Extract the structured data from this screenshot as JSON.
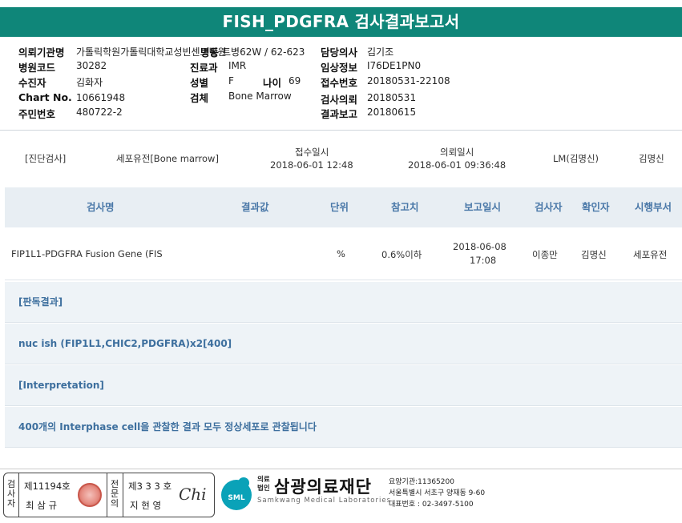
{
  "title": "FISH_PDGFRA 검사결과보고서",
  "patient": {
    "hospital_label": "의뢰기관명",
    "hospital_value": "가톨릭학원가톨릭대학교성빈센트병원",
    "ward_label": "병동",
    "ward_value": "트병62W / 62-623",
    "doctor_label": "담당의사",
    "doctor_value": "김기조",
    "code_label": "병원코드",
    "code_value": "30282",
    "dept_label": "진료과",
    "dept_value": "IMR",
    "clinical_label": "임상정보",
    "clinical_value": "I76DE1PN0",
    "patient_label": "수진자",
    "patient_value": "김화자",
    "sex_label": "성별",
    "sex_value": "F",
    "age_label": "나이",
    "age_value": "69",
    "receipt_label": "접수번호",
    "receipt_value": "20180531-22108",
    "chart_label": "Chart No.",
    "chart_value": "10661948",
    "specimen_label": "검체",
    "specimen_value": "Bone Marrow",
    "request_label": "검사의뢰",
    "request_value": "20180531",
    "resident_label": "주민번호",
    "resident_value": "480722-2",
    "report_label": "결과보고",
    "report_value": "20180615"
  },
  "sample": {
    "category": "[진단검사]",
    "dept": "세포유전[Bone marrow]",
    "received_label": "접수일시",
    "received_value": "2018-06-01 12:48",
    "requested_label": "의뢰일시",
    "requested_value": "2018-06-01 09:36:48",
    "lm": "LM(김명신)",
    "person": "김명신"
  },
  "table": {
    "headers": [
      "검사명",
      "결과값",
      "단위",
      "참고치",
      "보고일시",
      "검사자",
      "확인자",
      "시행부서"
    ],
    "row": {
      "test": "FIP1L1-PDGFRA Fusion Gene (FIS",
      "result": "",
      "unit": "%",
      "ref": "0.6%이하",
      "date": "2018-06-08",
      "time": "17:08",
      "tester": "이종만",
      "confirmer": "김명신",
      "dept": "세포유전"
    }
  },
  "findings": [
    "[판독결과]",
    "nuc ish (FIP1L1,CHIC2,PDGFRA)x2[400]",
    "[Interpretation]",
    "400개의 Interphase cell을 관찰한 결과  모두 정상세포로 관찰됩니다"
  ],
  "footer": {
    "examiner_label": [
      "검",
      "사",
      "자"
    ],
    "examiner_no": "제11194호",
    "examiner_name": "최 삼 규",
    "specialist_label": [
      "전",
      "문",
      "의"
    ],
    "specialist_no": "제3 3 3 호",
    "specialist_name": "지 현 영",
    "signature": "Chi",
    "logo_text": "SML",
    "org_prefix_1": "의료",
    "org_prefix_2": "법인",
    "org_name": "삼광의료재단",
    "org_en": "Samkwang Medical Laboratories",
    "org_code": "요양기관:11365200",
    "org_address": "서울특별시 서초구 양재동 9-60",
    "org_phone": "대표번호 : 02-3497-5100"
  },
  "colors": {
    "header": "#0f8679",
    "accent": "#3d6f9e",
    "band": "#eef3f7"
  }
}
